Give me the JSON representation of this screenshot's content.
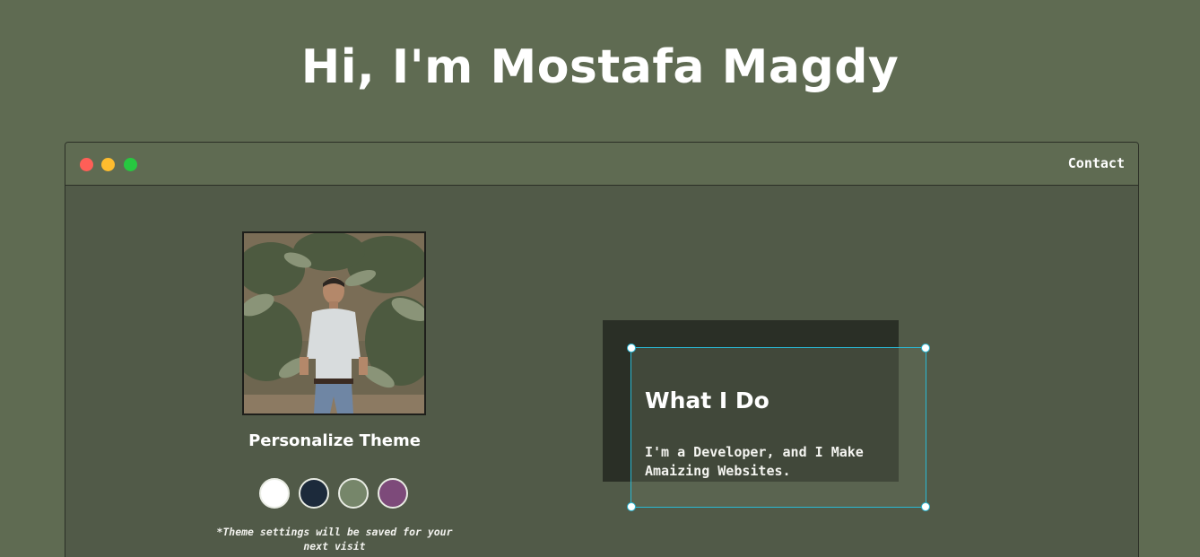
{
  "hero": {
    "title": "Hi, I'm Mostafa Magdy"
  },
  "window": {
    "controls": [
      "close",
      "minimize",
      "maximize"
    ],
    "nav": {
      "contact_label": "Contact"
    }
  },
  "profile": {
    "photo_icon": "profile-photo"
  },
  "theme": {
    "title": "Personalize Theme",
    "swatches": [
      {
        "name": "white",
        "color": "#ffffff"
      },
      {
        "name": "navy",
        "color": "#1c2a3b"
      },
      {
        "name": "sage",
        "color": "#76866a"
      },
      {
        "name": "purple",
        "color": "#7d4a7a"
      }
    ],
    "note": "*Theme settings will be saved for your next visit"
  },
  "card": {
    "title": "What I Do",
    "text": "I'm a Developer, and I Make Amaizing Websites."
  },
  "colors": {
    "background": "#5f6b52",
    "window_body": "#515a48",
    "card_shadow": "#2a2f26",
    "selection_outline": "#2ab8d4"
  }
}
